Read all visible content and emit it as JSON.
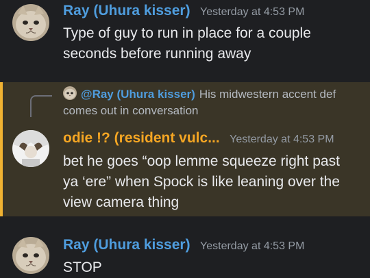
{
  "messages": [
    {
      "username": "Ray (Uhura kisser)",
      "timestamp": "Yesterday at 4:53 PM",
      "text": "Type of guy to run in place for a couple seconds before running away",
      "name_color": "#4f9dde"
    },
    {
      "username": "odie !? (resident vulc...",
      "timestamp": "Yesterday at 4:53 PM",
      "text": "bet he goes “oop lemme squeeze right past ya ‘ere” when Spock is like leaning over the view camera thing",
      "name_color": "#f5a623",
      "highlighted": true,
      "reply": {
        "username": "@Ray (Uhura kisser)",
        "text": "His midwestern accent def comes out in conversation"
      }
    },
    {
      "username": "Ray (Uhura kisser)",
      "timestamp": "Yesterday at 4:53 PM",
      "text": "STOP",
      "name_color": "#4f9dde"
    }
  ],
  "colors": {
    "background": "#1e1f22",
    "mention_highlight": "#3a3527",
    "mention_bar": "#f0b232"
  }
}
